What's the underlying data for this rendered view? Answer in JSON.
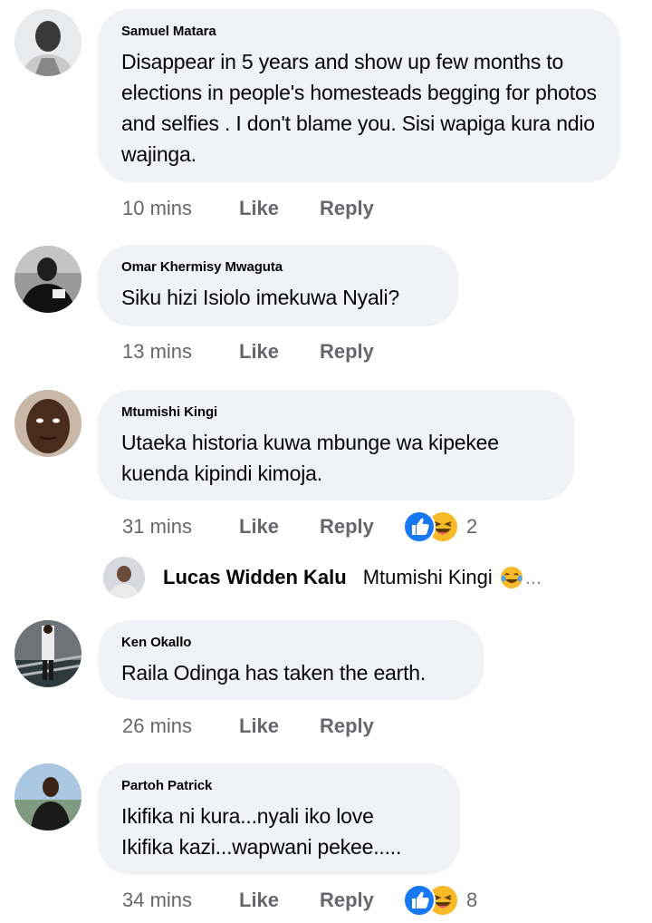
{
  "comments": [
    {
      "author": "Samuel Matara",
      "text": "Disappear in 5 years and show up few months to elections in people's homesteads begging for photos and selfies . I don't blame you. Sisi wapiga kura ndio wajinga.",
      "time": "10 mins",
      "like_label": "Like",
      "reply_label": "Reply"
    },
    {
      "author": "Omar Khermisy Mwaguta",
      "text": "Siku hizi Isiolo imekuwa Nyali?",
      "time": "13 mins",
      "like_label": "Like",
      "reply_label": "Reply"
    },
    {
      "author": "Mtumishi Kingi",
      "text": "Utaeka historia kuwa mbunge wa kipekee kuenda kipindi kimoja.",
      "time": "31 mins",
      "like_label": "Like",
      "reply_label": "Reply",
      "reaction_count": "2",
      "reactions": [
        "like-icon",
        "laughing-emoji-icon"
      ]
    },
    {
      "author": "Ken Okallo",
      "text": "Raila Odinga has taken the earth.",
      "time": "26 mins",
      "like_label": "Like",
      "reply_label": "Reply"
    },
    {
      "author": "Partoh Patrick",
      "text": "Ikifika ni kura...nyali iko love\nIkifika kazi...wapwani pekee.....",
      "time": "34 mins",
      "like_label": "Like",
      "reply_label": "Reply",
      "reaction_count": "8",
      "reactions": [
        "like-icon",
        "laughing-emoji-icon"
      ]
    }
  ],
  "reply_preview": {
    "author": "Lucas Widden Kalu",
    "text": "Mtumishi Kingi",
    "emoji": "tears-of-joy-emoji-icon",
    "ellipsis": "..."
  },
  "colors": {
    "bubble": "#f0f2f5",
    "secondary_text": "#65676b",
    "like_blue": "#1877f2",
    "emoji_yellow": "#f7b928"
  }
}
